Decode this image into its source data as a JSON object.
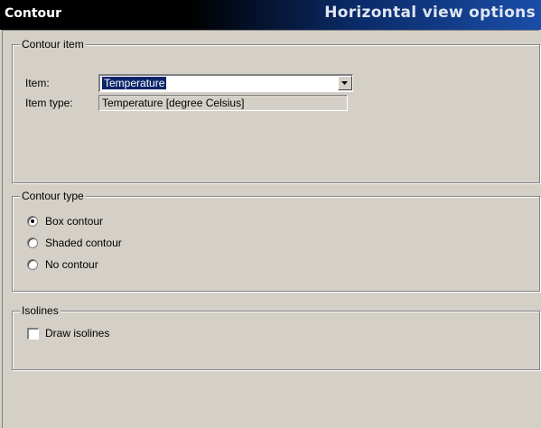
{
  "header": {
    "title": "Contour",
    "subtitle": "Horizontal view options"
  },
  "contour_item": {
    "legend": "Contour item",
    "item_label": "Item:",
    "item_value": "Temperature",
    "item_type_label": "Item type:",
    "item_type_value": "Temperature  [degree Celsius]"
  },
  "contour_type": {
    "legend": "Contour type",
    "options": [
      {
        "label": "Box contour",
        "selected": true
      },
      {
        "label": "Shaded contour",
        "selected": false
      },
      {
        "label": "No contour",
        "selected": false
      }
    ]
  },
  "isolines": {
    "legend": "Isolines",
    "draw_label": "Draw isolines",
    "checked": false
  }
}
